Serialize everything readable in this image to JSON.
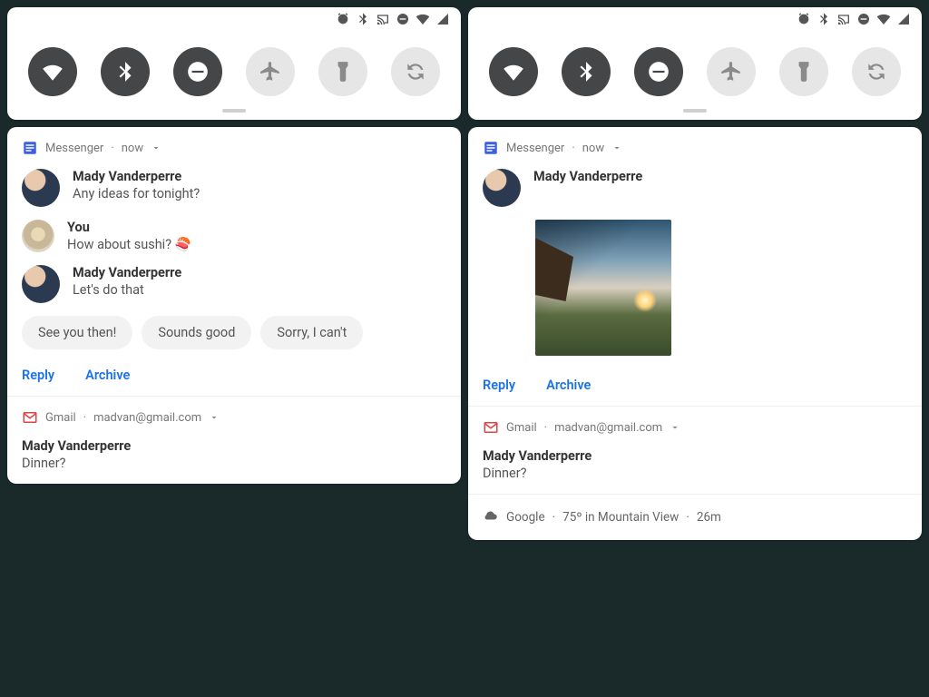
{
  "quick_settings": {
    "tiles": [
      {
        "name": "wifi",
        "on": true
      },
      {
        "name": "bluetooth",
        "on": true
      },
      {
        "name": "dnd",
        "on": true
      },
      {
        "name": "airplane",
        "on": false
      },
      {
        "name": "flashlight",
        "on": false
      },
      {
        "name": "rotation",
        "on": false
      }
    ],
    "status_icons": [
      "alarm",
      "bluetooth",
      "cast",
      "dnd",
      "wifi",
      "signal"
    ]
  },
  "panel_left": {
    "messenger": {
      "app": "Messenger",
      "time": "now",
      "messages": [
        {
          "sender": "Mady Vanderperre",
          "body": "Any ideas for tonight?"
        },
        {
          "sender": "You",
          "body": "How about sushi? 🍣"
        },
        {
          "sender": "Mady Vanderperre",
          "body": "Let's do that"
        }
      ],
      "smart_replies": [
        "See you then!",
        "Sounds good",
        "Sorry, I can't"
      ],
      "actions": {
        "reply": "Reply",
        "archive": "Archive"
      }
    },
    "gmail": {
      "app": "Gmail",
      "account": "madvan@gmail.com",
      "from": "Mady Vanderperre",
      "subject": "Dinner?"
    }
  },
  "panel_right": {
    "messenger": {
      "app": "Messenger",
      "time": "now",
      "sender": "Mady Vanderperre",
      "attachment": "image",
      "actions": {
        "reply": "Reply",
        "archive": "Archive"
      }
    },
    "gmail": {
      "app": "Gmail",
      "account": "madvan@gmail.com",
      "from": "Mady Vanderperre",
      "subject": "Dinner?"
    },
    "weather": {
      "provider": "Google",
      "summary": "75º in Mountain View",
      "age": "26m"
    }
  }
}
